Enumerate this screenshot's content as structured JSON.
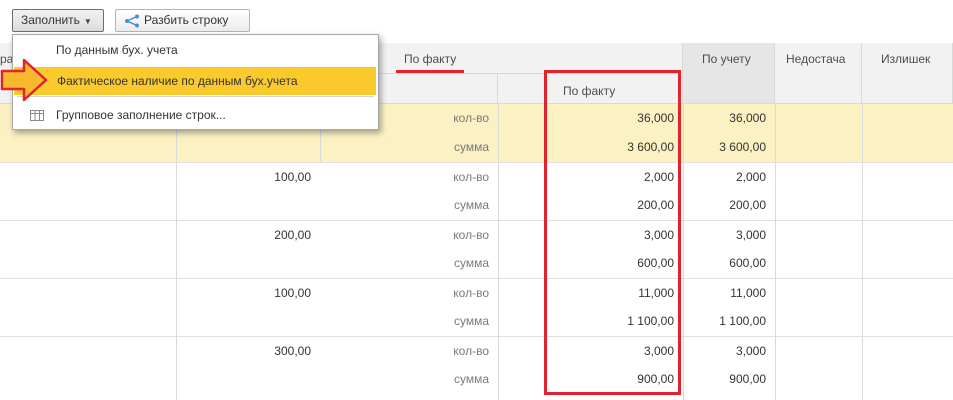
{
  "toolbar": {
    "fill_label": "Заполнить",
    "split_label": "Разбить строку"
  },
  "menu": {
    "items": [
      {
        "label": "По данным бух. учета"
      },
      {
        "label": "Фактическое наличие по данным бух.учета"
      },
      {
        "label": "Групповое заполнение строк..."
      }
    ]
  },
  "headers": {
    "partial_left": "ра",
    "group_fact": "По факту",
    "sub_fact": "По факту",
    "by_account": "По учету",
    "shortage": "Недостача",
    "surplus": "Излишек"
  },
  "rows": [
    {
      "price": "",
      "kind": "кол-во",
      "fact": "36,000",
      "account": "36,000",
      "highlight": true
    },
    {
      "price": "",
      "kind": "сумма",
      "fact": "3 600,00",
      "account": "3 600,00",
      "highlight": true
    },
    {
      "price": "100,00",
      "kind": "кол-во",
      "fact": "2,000",
      "account": "2,000",
      "highlight": false
    },
    {
      "price": "",
      "kind": "сумма",
      "fact": "200,00",
      "account": "200,00",
      "highlight": false
    },
    {
      "price": "200,00",
      "kind": "кол-во",
      "fact": "3,000",
      "account": "3,000",
      "highlight": false
    },
    {
      "price": "",
      "kind": "сумма",
      "fact": "600,00",
      "account": "600,00",
      "highlight": false
    },
    {
      "price": "100,00",
      "kind": "кол-во",
      "fact": "11,000",
      "account": "11,000",
      "highlight": false
    },
    {
      "price": "",
      "kind": "сумма",
      "fact": "1 100,00",
      "account": "1 100,00",
      "highlight": false
    },
    {
      "price": "300,00",
      "kind": "кол-во",
      "fact": "3,000",
      "account": "3,000",
      "highlight": false
    },
    {
      "price": "",
      "kind": "сумма",
      "fact": "900,00",
      "account": "900,00",
      "highlight": false
    }
  ],
  "colors": {
    "highlight_row": "#fbf1c2",
    "menu_active": "#fac92c",
    "annotation_red": "#e0232c",
    "arrow_orange": "#f5b82e"
  }
}
